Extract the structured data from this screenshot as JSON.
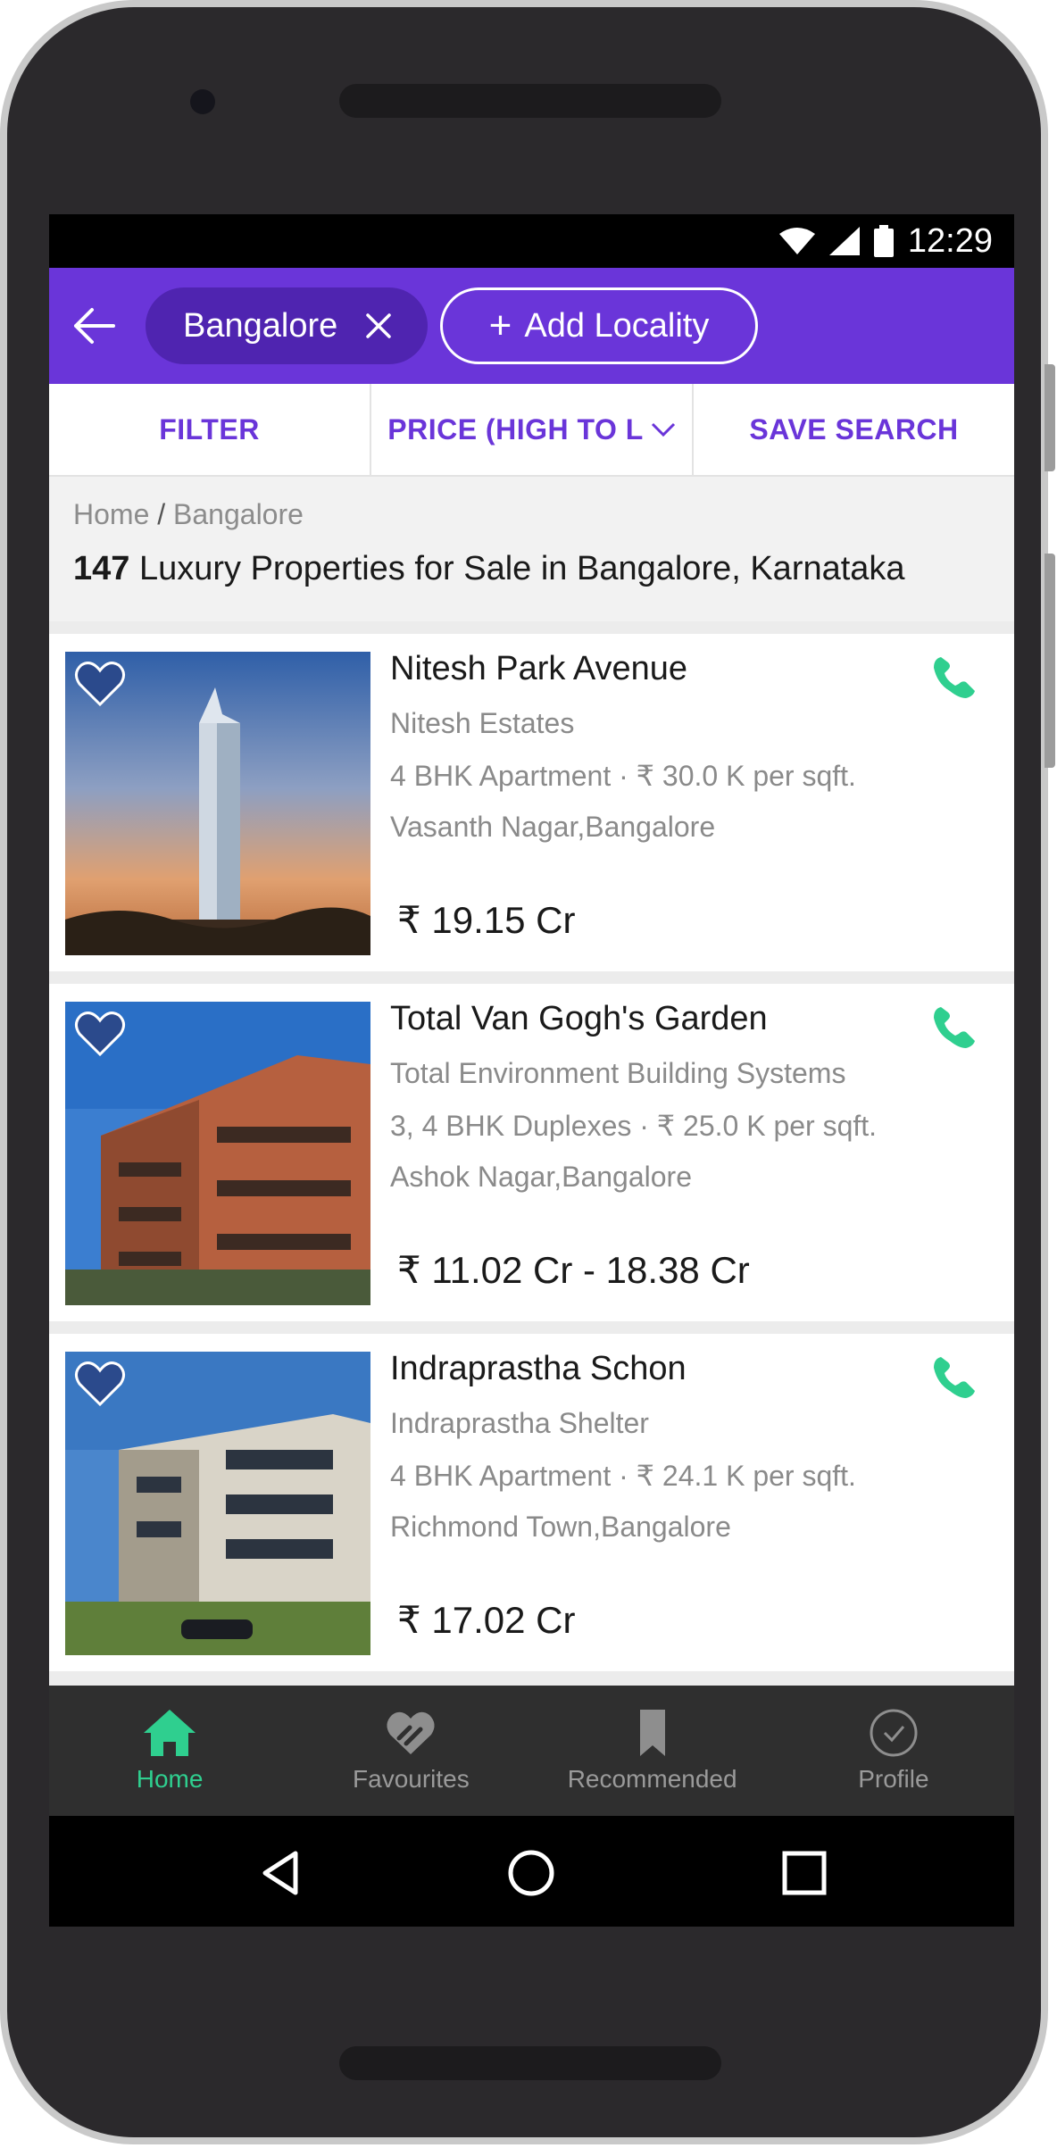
{
  "status_bar": {
    "time": "12:29"
  },
  "app_bar": {
    "city_chip": "Bangalore",
    "add_locality": "Add Locality",
    "add_symbol": "+"
  },
  "toolbar": {
    "filter": "FILTER",
    "sort": "PRICE (HIGH TO L",
    "save_search": "SAVE SEARCH"
  },
  "breadcrumb": {
    "home": "Home",
    "separator": " / ",
    "city": "Bangalore"
  },
  "results": {
    "count": "147",
    "title": " Luxury Properties for Sale in Bangalore, Karnataka"
  },
  "listings": [
    {
      "name": "Nitesh Park Avenue",
      "builder": "Nitesh Estates",
      "config": "4 BHK Apartment",
      "rate": "₹ 30.0 K per sqft.",
      "locality": "Vasanth Nagar,Bangalore",
      "price": "₹ 19.15 Cr"
    },
    {
      "name": "Total Van Gogh's Garden",
      "builder": "Total Environment Building Systems",
      "config": "3, 4 BHK Duplexes",
      "rate": "₹ 25.0 K per sqft.",
      "locality": "Ashok Nagar,Bangalore",
      "price": "₹ 11.02 Cr - 18.38 Cr"
    },
    {
      "name": "Indraprastha Schon",
      "builder": "Indraprastha Shelter",
      "config": "4 BHK Apartment",
      "rate": "₹ 24.1 K per sqft.",
      "locality": "Richmond Town,Bangalore",
      "price": "₹ 17.02 Cr"
    }
  ],
  "bottom_nav": {
    "home": "Home",
    "favourites": "Favourites",
    "recommended": "Recommended",
    "profile": "Profile"
  },
  "colors": {
    "brand_purple": "#6a35d9",
    "chip_dark_purple": "#4f24b0",
    "accent_green": "#2fcf8f"
  },
  "icons": {
    "back": "arrow-left-icon",
    "chip_close": "close-icon",
    "sort_dropdown": "chevron-down-icon",
    "favourite": "heart-icon",
    "call": "phone-icon",
    "nav_home": "home-icon",
    "nav_favourites": "favourites-icon",
    "nav_recommended": "bookmark-icon",
    "nav_profile": "check-circle-icon"
  }
}
